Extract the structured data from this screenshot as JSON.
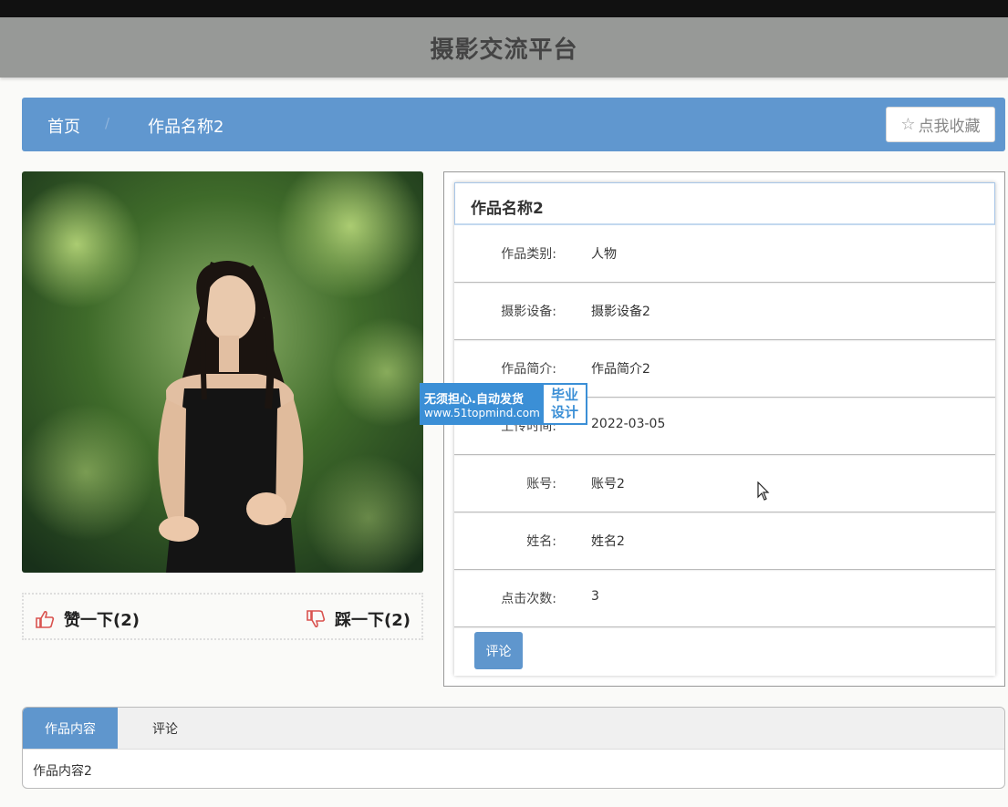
{
  "site": {
    "title": "摄影交流平台"
  },
  "breadcrumb": {
    "home": "首页",
    "separator": "/",
    "current": "作品名称2"
  },
  "favorite": {
    "icon": "star-outline-icon",
    "label": "点我收藏"
  },
  "votes": {
    "like": {
      "icon": "thumbs-up-icon",
      "label": "赞一下(2)"
    },
    "dislike": {
      "icon": "thumbs-down-icon",
      "label": "踩一下(2)"
    }
  },
  "watermark": {
    "line1": "无须担心.自动发货",
    "line2": "www.51topmind.com",
    "tag1": "毕业",
    "tag2": "设计"
  },
  "work": {
    "title": "作品名称2",
    "fields": [
      {
        "label": "作品类别:",
        "value": "人物"
      },
      {
        "label": "摄影设备:",
        "value": "摄影设备2"
      },
      {
        "label": "作品简介:",
        "value": "作品简介2"
      },
      {
        "label": "上传时间:",
        "value": "2022-03-05"
      },
      {
        "label": "账号:",
        "value": "账号2"
      },
      {
        "label": "姓名:",
        "value": "姓名2"
      },
      {
        "label": "点击次数:",
        "value": "3"
      }
    ],
    "comment_button": "评论"
  },
  "tabs": [
    {
      "label": "作品内容",
      "active": true
    },
    {
      "label": "评论",
      "active": false
    }
  ],
  "tab_content": "作品内容2",
  "colors": {
    "primary": "#6097cf",
    "header": "#979997",
    "topbar": "#111111",
    "like": "#d9534f"
  }
}
